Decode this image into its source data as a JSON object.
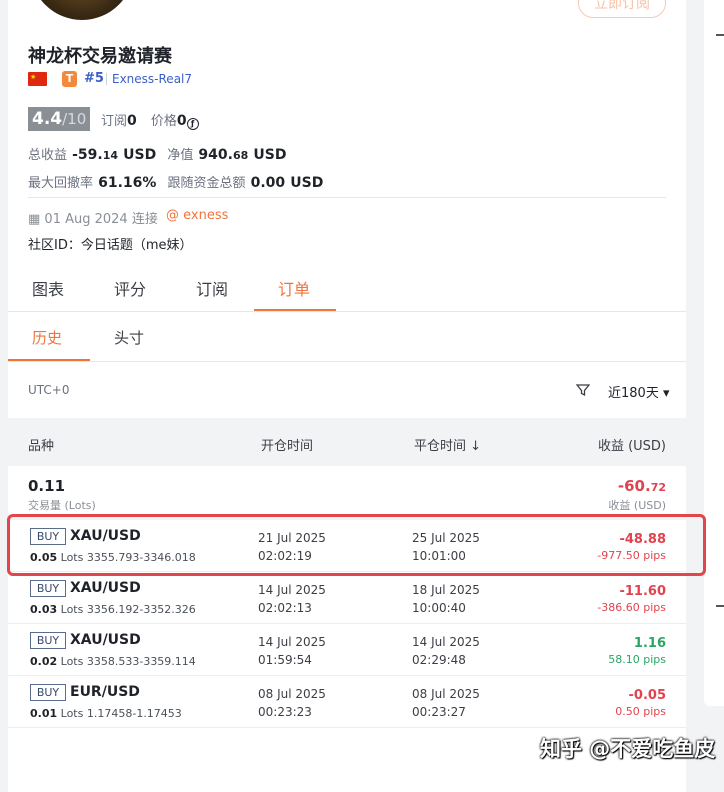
{
  "profile": {
    "subscribe_label": "立即订阅",
    "name": "神龙杯交易邀请赛",
    "flag_star": "★",
    "tier": "T",
    "rank": "#5",
    "server": "Exness-Real7",
    "score": "4.4",
    "score_of": "/10",
    "subscriptions_label": "订阅",
    "subscriptions_value": "0",
    "price_label": "价格",
    "price_value": "0",
    "coin_symbol": "ƒ",
    "total_profit_label": "总收益",
    "total_profit_value": "-59.",
    "total_profit_cents": "14",
    "total_profit_unit": "USD",
    "equity_label": "净值",
    "equity_value": "940.",
    "equity_cents": "68",
    "equity_unit": "USD",
    "max_drawdown_label": "最大回撤率",
    "max_drawdown_value": "61.16%",
    "follow_funds_label": "跟随资金总额",
    "follow_funds_value": "0.00",
    "follow_funds_unit": "USD",
    "connected": "01 Aug 2024 连接",
    "broker": "@ exness",
    "community": "社区ID：今日话题（me妹）"
  },
  "tabs": [
    "图表",
    "评分",
    "订阅",
    "订单"
  ],
  "subtabs": [
    "历史",
    "头寸"
  ],
  "filter": {
    "timezone": "UTC+0",
    "period": "近180天 ▾"
  },
  "table": {
    "headers": [
      "品种",
      "开仓时间",
      "平仓时间 ↓",
      "收益 (USD)"
    ],
    "summary": {
      "lots": "0.11",
      "lots_label": "交易量 (Lots)",
      "profit": "-60.",
      "profit_cents": "72",
      "profit_label": "收益 (USD)"
    },
    "rows": [
      {
        "side": "BUY",
        "symbol": "XAU/USD",
        "lots": "0.05",
        "lots_unit": "Lots",
        "prices": "3355.793-3346.018",
        "open_date": "21 Jul 2025",
        "open_time": "02:02:19",
        "close_date": "25 Jul 2025",
        "close_time": "10:01:00",
        "profit": "-48.88",
        "pips": "-977.50 pips"
      },
      {
        "side": "BUY",
        "symbol": "XAU/USD",
        "lots": "0.03",
        "lots_unit": "Lots",
        "prices": "3356.192-3352.326",
        "open_date": "14 Jul 2025",
        "open_time": "02:02:13",
        "close_date": "18 Jul 2025",
        "close_time": "10:00:40",
        "profit": "-11.60",
        "pips": "-386.60 pips"
      },
      {
        "side": "BUY",
        "symbol": "XAU/USD",
        "lots": "0.02",
        "lots_unit": "Lots",
        "prices": "3358.533-3359.114",
        "open_date": "14 Jul 2025",
        "open_time": "01:59:54",
        "close_date": "14 Jul 2025",
        "close_time": "02:29:48",
        "profit": "1.16",
        "pips": "58.10 pips"
      },
      {
        "side": "BUY",
        "symbol": "EUR/USD",
        "lots": "0.01",
        "lots_unit": "Lots",
        "prices": "1.17458-1.17453",
        "open_date": "08 Jul 2025",
        "open_time": "00:23:23",
        "close_date": "08 Jul 2025",
        "close_time": "00:23:27",
        "profit": "-0.05",
        "pips": "0.50 pips"
      }
    ]
  },
  "watermark": "知乎 @不爱吃鱼皮",
  "colors": {
    "accent": "#f0743e",
    "negative": "#e0434f",
    "positive": "#2aa664",
    "highlight": "#e2454a"
  }
}
